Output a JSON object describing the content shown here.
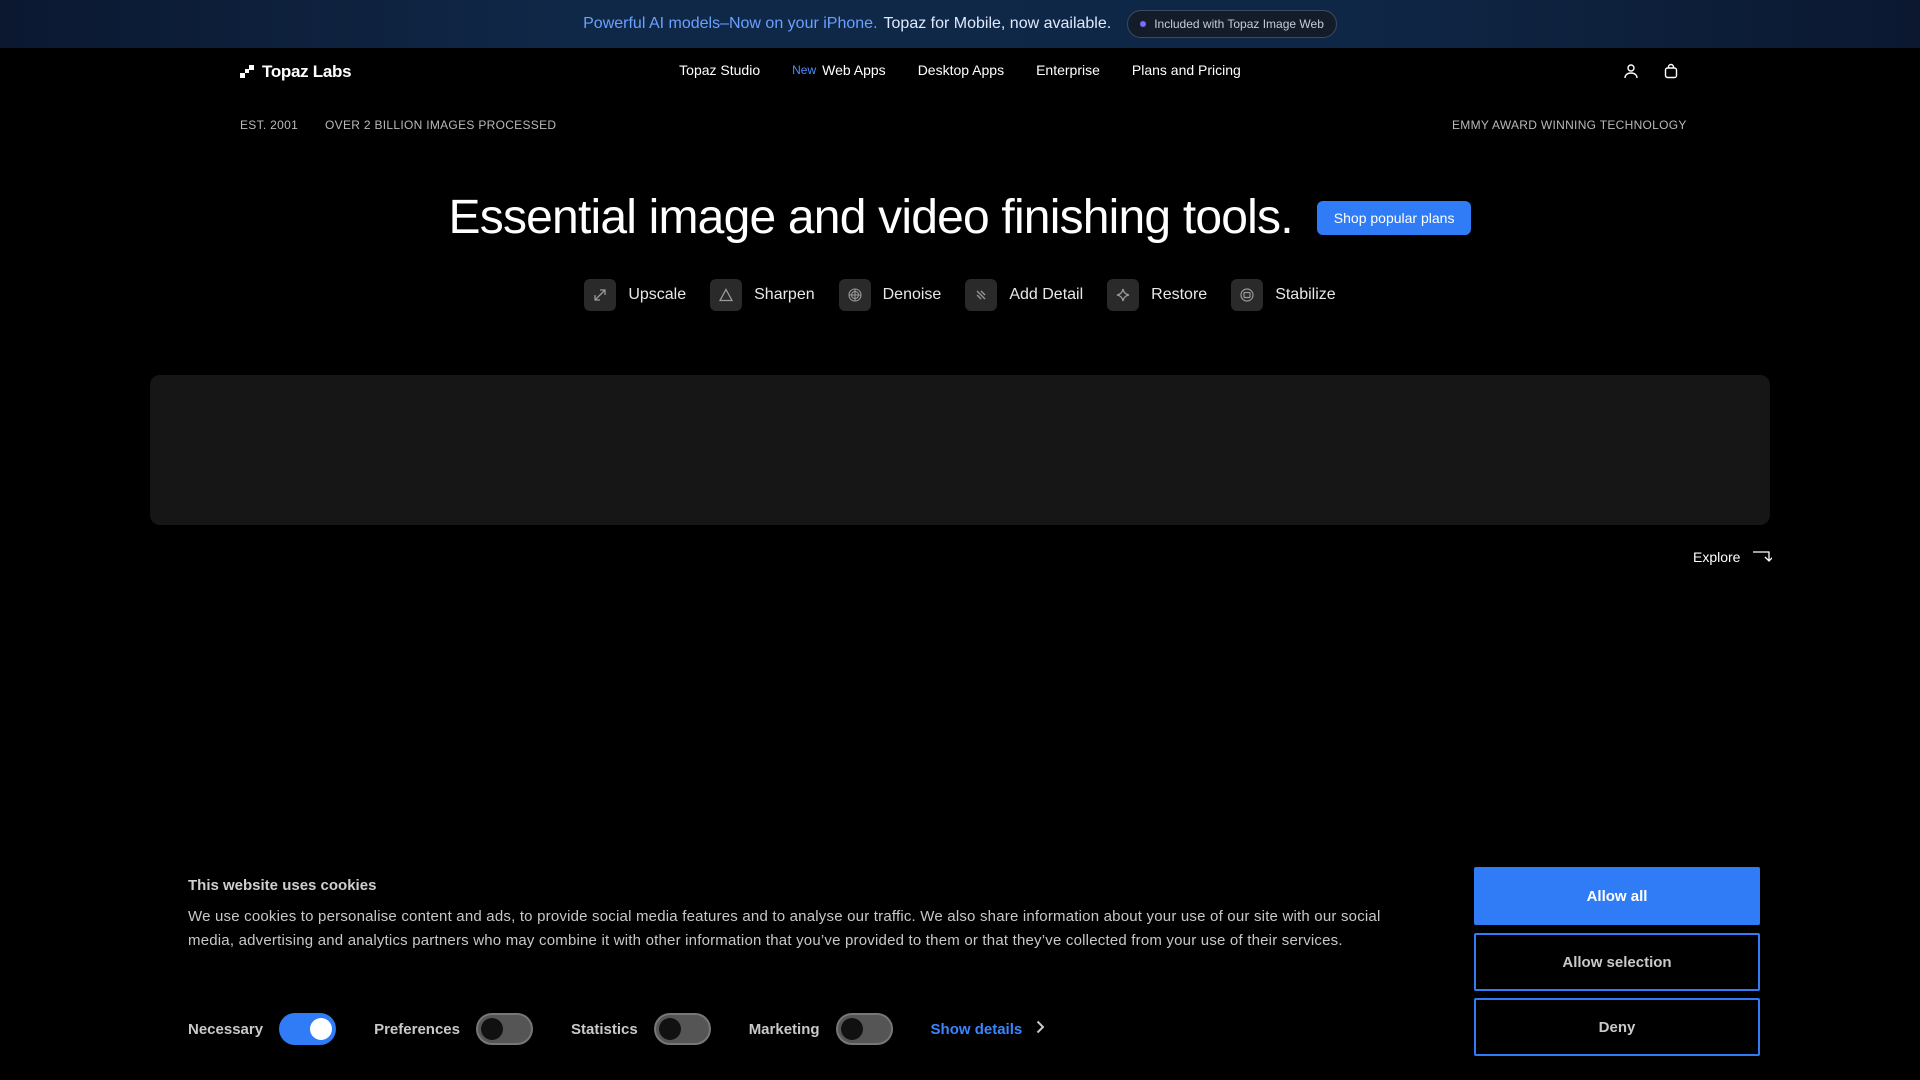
{
  "announcement": {
    "highlight": "Powerful AI models–Now on your iPhone.",
    "text": "Topaz for Mobile, now available.",
    "pill": "Included with Topaz Image Web"
  },
  "nav": {
    "logo": "Topaz Labs",
    "items": [
      {
        "label": "Topaz Studio",
        "badge": ""
      },
      {
        "label": "Web Apps",
        "badge": "New"
      },
      {
        "label": "Desktop Apps",
        "badge": ""
      },
      {
        "label": "Enterprise",
        "badge": ""
      },
      {
        "label": "Plans and Pricing",
        "badge": ""
      }
    ],
    "icons": [
      "user-icon",
      "cart-icon"
    ]
  },
  "stats": {
    "est": "EST. 2001",
    "images": "OVER 2 BILLION IMAGES PROCESSED",
    "award": "EMMY AWARD WINNING TECHNOLOGY"
  },
  "hero": {
    "title": "Essential image and video finishing tools.",
    "cta": "Shop popular plans"
  },
  "features": [
    {
      "label": "Upscale",
      "icon": "upscale-icon"
    },
    {
      "label": "Sharpen",
      "icon": "sharpen-icon"
    },
    {
      "label": "Denoise",
      "icon": "denoise-icon"
    },
    {
      "label": "Add Detail",
      "icon": "add-detail-icon"
    },
    {
      "label": "Restore",
      "icon": "restore-icon"
    },
    {
      "label": "Stabilize",
      "icon": "stabilize-icon"
    }
  ],
  "explore": "Explore",
  "cookie": {
    "title": "This website uses cookies",
    "body": "We use cookies to personalise content and ads, to provide social media features and to analyse our traffic. We also share information about your use of our site with our social media, advertising and analytics partners who may combine it with other information that you’ve provided to them or that they’ve collected from your use of their services.",
    "toggles": [
      {
        "label": "Necessary",
        "on": true
      },
      {
        "label": "Preferences",
        "on": false
      },
      {
        "label": "Statistics",
        "on": false
      },
      {
        "label": "Marketing",
        "on": false
      }
    ],
    "show_details": "Show details",
    "allow_all": "Allow all",
    "allow_selection": "Allow selection",
    "deny": "Deny"
  },
  "colors": {
    "accent": "#2f7cf6",
    "link": "#3a85ff",
    "announce_highlight": "#6aa0ff"
  }
}
